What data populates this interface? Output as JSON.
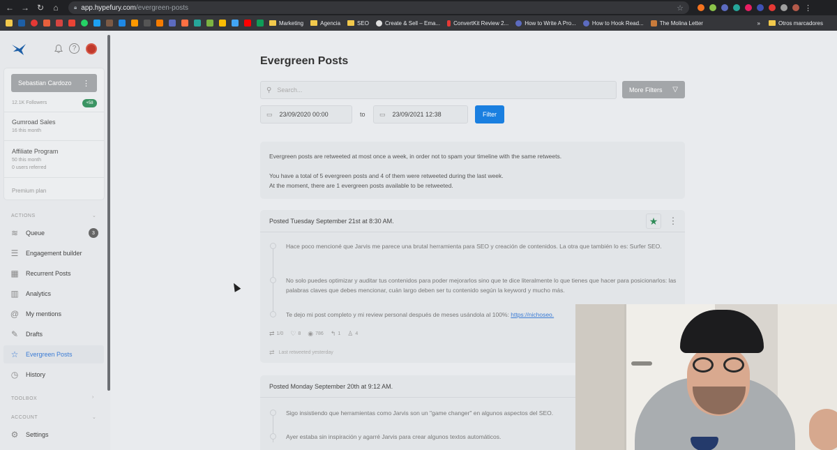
{
  "browser": {
    "url_host": "app.hypefury.com",
    "url_path": "/evergreen-posts",
    "bookmarks": [
      {
        "label": "Marketing",
        "type": "folder"
      },
      {
        "label": "Agencia",
        "type": "folder"
      },
      {
        "label": "SEO",
        "type": "folder"
      },
      {
        "label": "Create & Sell – Ema...",
        "type": "site",
        "color": "#e0e0e0"
      },
      {
        "label": "ConvertKit Review 2...",
        "type": "site",
        "color": "#e53935"
      },
      {
        "label": "How to Write A Pro...",
        "type": "site",
        "color": "#5c6bc0"
      },
      {
        "label": "How to Hook Read...",
        "type": "site",
        "color": "#5c6bc0"
      },
      {
        "label": "The Molina Letter",
        "type": "site",
        "color": "#c97b3b"
      }
    ],
    "more_bookmarks": "»",
    "other_bookmarks": "Otros marcadores"
  },
  "sidebar": {
    "user_name": "Sebastian Cardozo",
    "followers": "12.1K Followers",
    "followers_delta": "+58",
    "metrics": [
      {
        "title": "Gumroad Sales",
        "sub": "16 this month"
      },
      {
        "title": "Affiliate Program",
        "sub": "50 this month",
        "sub2": "0 users referred"
      }
    ],
    "plan": "Premium plan",
    "sections": {
      "actions": "ACTIONS",
      "toolbox": "TOOLBOX",
      "account": "ACCOUNT"
    },
    "nav": [
      {
        "label": "Queue",
        "icon": "layers-icon",
        "badge": "3"
      },
      {
        "label": "Engagement builder",
        "icon": "list-icon"
      },
      {
        "label": "Recurrent Posts",
        "icon": "calendar-icon"
      },
      {
        "label": "Analytics",
        "icon": "chart-icon"
      },
      {
        "label": "My mentions",
        "icon": "at-icon"
      },
      {
        "label": "Drafts",
        "icon": "edit-icon"
      },
      {
        "label": "Evergreen Posts",
        "icon": "star-icon",
        "active": true
      },
      {
        "label": "History",
        "icon": "clock-icon"
      }
    ],
    "settings": "Settings"
  },
  "main": {
    "title": "Evergreen Posts",
    "search_placeholder": "Search...",
    "more_filters": "More Filters",
    "date_from": "23/09/2020 00:00",
    "to": "to",
    "date_to": "23/09/2021 12:38",
    "filter": "Filter",
    "info": [
      "Evergreen posts are retweeted at most once a week, in order not to spam your timeline with the same retweets.",
      "You have a total of 5 evergreen posts and 4 of them were retweeted during the last week.",
      "At the moment, there are 1 evergreen posts available to be retweeted."
    ],
    "posts": [
      {
        "header": "Posted Tuesday September 21st at 8:30 AM.",
        "tweets": [
          "Hace poco mencioné que Jarvis me parece una brutal herramienta para SEO y creación de contenidos. La otra que también lo es: Surfer SEO.",
          "No solo puedes optimizar y auditar tus contenidos para poder mejorarlos sino que te dice literalmente lo que tienes que hacer para posicionarlos: las palabras claves que debes mencionar, cuán largo deben ser tu contenido según la keyword y mucho más.",
          "Te dejo mi post completo y mi review personal después de meses usándola al 100%:"
        ],
        "link": "https://nichoseo.",
        "stats": {
          "retweets": "1/0",
          "likes": "8",
          "views": "786",
          "replies": "1",
          "profile": "4"
        },
        "last_retweeted": "Last retweeted yesterday"
      },
      {
        "header": "Posted Monday September 20th at 9:12 AM.",
        "tweets": [
          "Sigo insistiendo que herramientas como Jarvis son un \"game changer\" en algunos aspectos del SEO.",
          "Ayer estaba sin inspiración y agarré Jarvis para crear algunos textos automáticos."
        ]
      }
    ]
  },
  "colors": {
    "accent": "#1a7fe0",
    "active_nav": "#3a7bd5",
    "badge_green": "#3b9463",
    "star_green": "#2e8b57"
  }
}
